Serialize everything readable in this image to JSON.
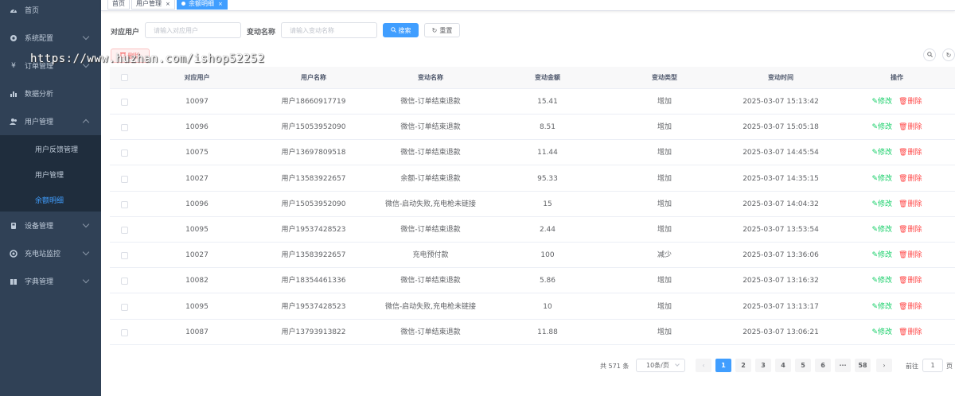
{
  "sidebar": {
    "items": [
      {
        "label": "首页",
        "icon": "dashboard-icon"
      },
      {
        "label": "系统配置",
        "icon": "gear-icon"
      },
      {
        "label": "订单管理",
        "icon": "yen-icon"
      },
      {
        "label": "数据分析",
        "icon": "bar-chart-icon"
      },
      {
        "label": "用户管理",
        "icon": "users-icon"
      },
      {
        "label": "设备管理",
        "icon": "device-icon"
      },
      {
        "label": "充电站监控",
        "icon": "monitor-icon"
      },
      {
        "label": "字典管理",
        "icon": "book-icon"
      }
    ],
    "sub_items": [
      {
        "label": "用户反馈管理"
      },
      {
        "label": "用户管理"
      },
      {
        "label": "余额明细"
      }
    ]
  },
  "tags": [
    {
      "label": "首页"
    },
    {
      "label": "用户管理",
      "close": "×"
    },
    {
      "label": "余额明细",
      "close": "×"
    }
  ],
  "search": {
    "user_label": "对应用户",
    "user_placeholder": "请输入对应用户",
    "name_label": "变动名称",
    "name_placeholder": "请输入变动名称",
    "search_btn": "搜索",
    "reset_btn": "重置"
  },
  "toolbar": {
    "delete_btn": "删除"
  },
  "watermark": "https://www.huzhan.com/ishop52252",
  "table": {
    "columns": [
      "对应用户",
      "用户名称",
      "变动名称",
      "变动金额",
      "变动类型",
      "变动时间",
      "操作"
    ],
    "rows": [
      {
        "uid": "10097",
        "name": "用户18660917719",
        "change": "微信-订单结束退款",
        "amount": "15.41",
        "type": "增加",
        "time": "2025-03-07 15:13:42"
      },
      {
        "uid": "10096",
        "name": "用户15053952090",
        "change": "微信-订单结束退款",
        "amount": "8.51",
        "type": "增加",
        "time": "2025-03-07 15:05:18"
      },
      {
        "uid": "10075",
        "name": "用户13697809518",
        "change": "微信-订单结束退款",
        "amount": "11.44",
        "type": "增加",
        "time": "2025-03-07 14:45:54"
      },
      {
        "uid": "10027",
        "name": "用户13583922657",
        "change": "余额-订单结束退款",
        "amount": "95.33",
        "type": "增加",
        "time": "2025-03-07 14:35:15"
      },
      {
        "uid": "10096",
        "name": "用户15053952090",
        "change": "微信-启动失败,充电枪未链接",
        "amount": "15",
        "type": "增加",
        "time": "2025-03-07 14:04:32"
      },
      {
        "uid": "10095",
        "name": "用户19537428523",
        "change": "微信-订单结束退款",
        "amount": "2.44",
        "type": "增加",
        "time": "2025-03-07 13:53:54"
      },
      {
        "uid": "10027",
        "name": "用户13583922657",
        "change": "充电预付款",
        "amount": "100",
        "type": "减少",
        "time": "2025-03-07 13:36:06"
      },
      {
        "uid": "10082",
        "name": "用户18354461336",
        "change": "微信-订单结束退款",
        "amount": "5.86",
        "type": "增加",
        "time": "2025-03-07 13:16:32"
      },
      {
        "uid": "10095",
        "name": "用户19537428523",
        "change": "微信-启动失败,充电枪未链接",
        "amount": "10",
        "type": "增加",
        "time": "2025-03-07 13:13:17"
      },
      {
        "uid": "10087",
        "name": "用户13793913822",
        "change": "微信-订单结束退款",
        "amount": "11.88",
        "type": "增加",
        "time": "2025-03-07 13:06:21"
      }
    ],
    "edit_label": "修改",
    "delete_label": "删除"
  },
  "pagination": {
    "total": "共 571 条",
    "page_size": "10条/页",
    "pages": [
      "1",
      "2",
      "3",
      "4",
      "5",
      "6",
      "···",
      "58"
    ],
    "current": "1",
    "goto_label": "前往",
    "goto_value": "1",
    "page_suffix": "页"
  },
  "colors": {
    "primary": "#409eff",
    "sidebar_bg": "#304156",
    "submenu_bg": "#1f2d3d",
    "edit": "#13ce66",
    "danger": "#ff4949"
  }
}
